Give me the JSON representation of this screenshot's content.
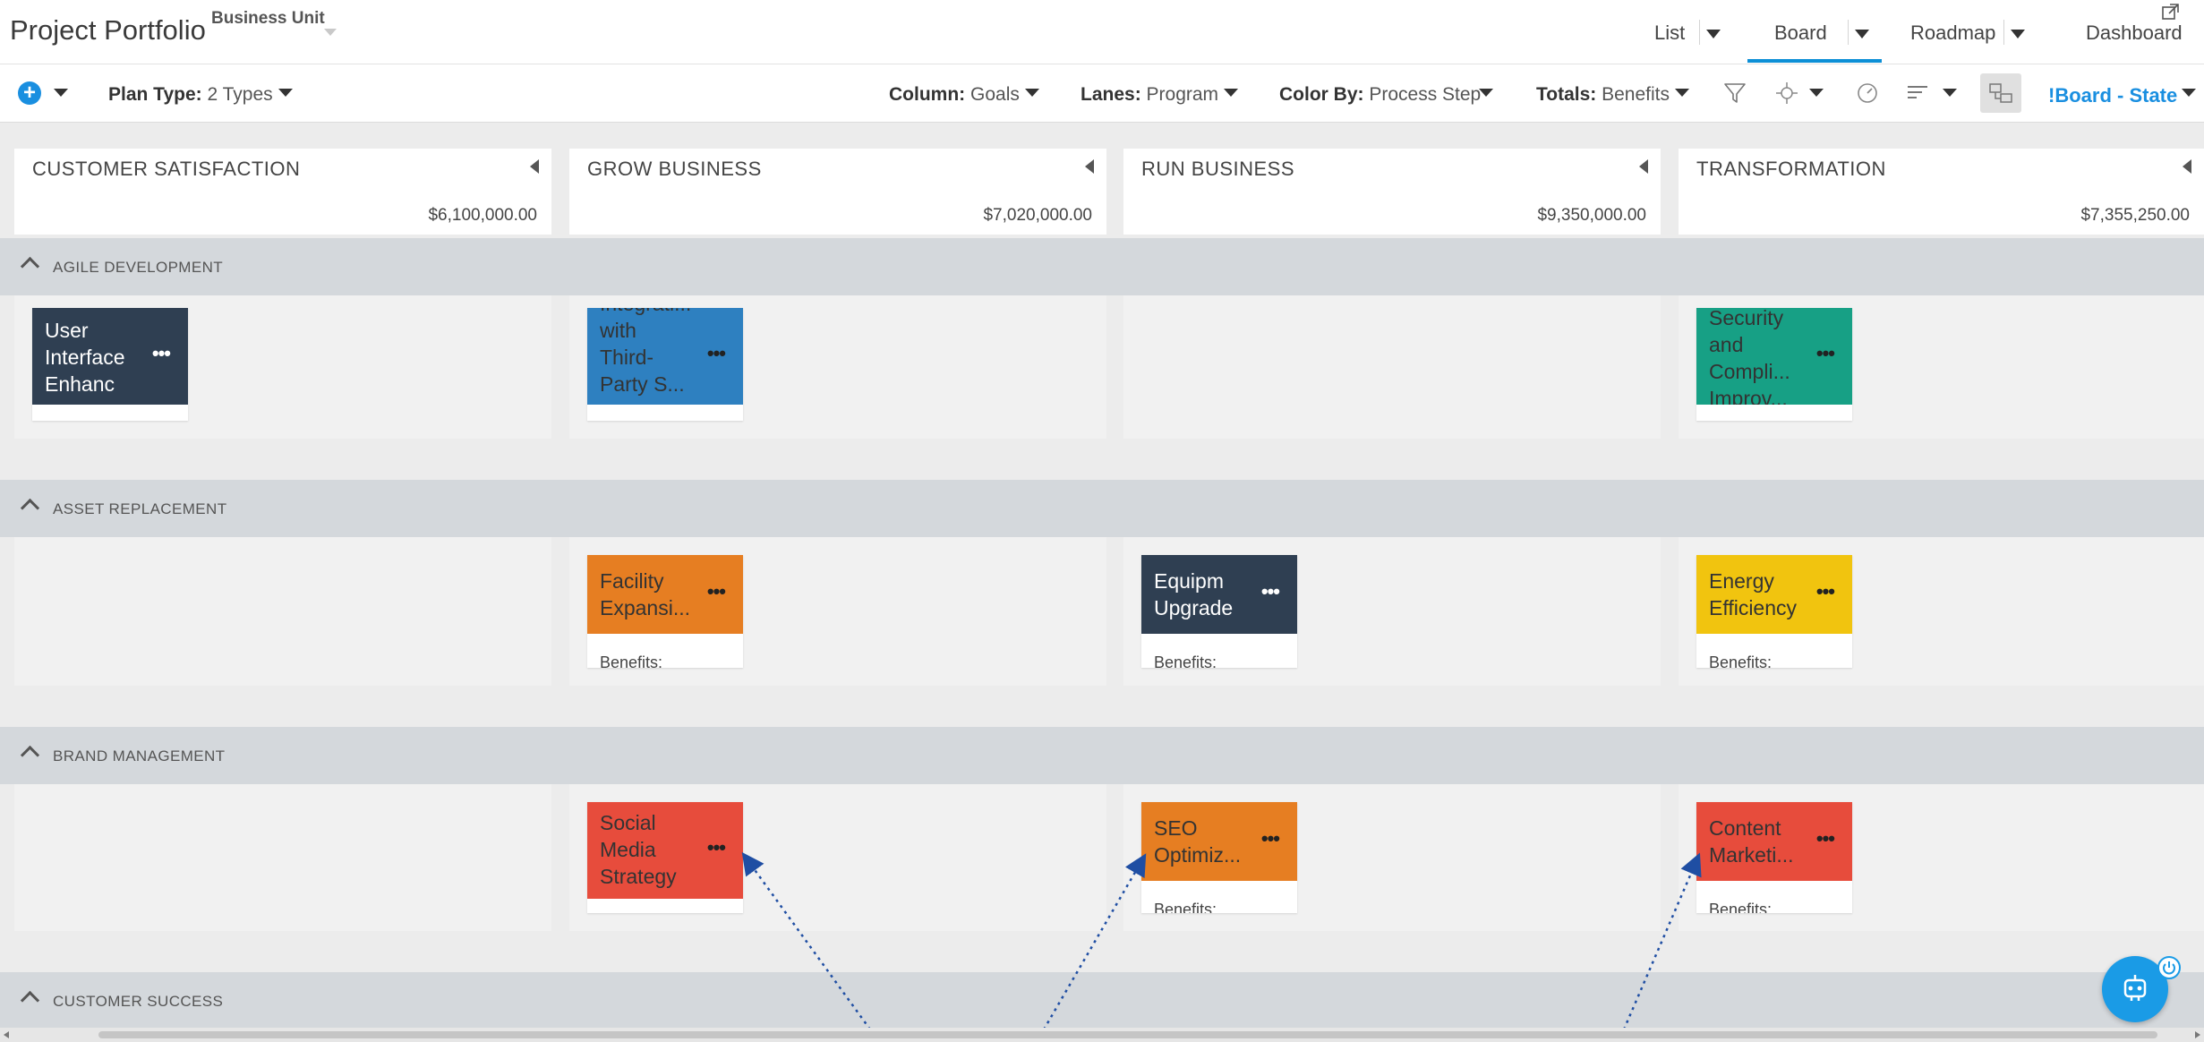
{
  "header": {
    "app_title": "Project Portfolio",
    "business_unit_label": "Business Unit",
    "nav": [
      {
        "label": "List"
      },
      {
        "label": "Board",
        "active": true
      },
      {
        "label": "Roadmap"
      },
      {
        "label": "Dashboard"
      }
    ]
  },
  "toolbar": {
    "plan_type": {
      "label": "Plan Type:",
      "value": "2 Types"
    },
    "column": {
      "label": "Column:",
      "value": "Goals"
    },
    "lanes": {
      "label": "Lanes:",
      "value": "Program"
    },
    "color_by": {
      "label": "Color By:",
      "value": "Process Step"
    },
    "totals": {
      "label": "Totals:",
      "value": "Benefits"
    },
    "view_state": "!Board - State"
  },
  "columns": [
    {
      "title": "CUSTOMER SATISFACTION",
      "total": "$6,100,000.00"
    },
    {
      "title": "GROW BUSINESS",
      "total": "$7,020,000.00"
    },
    {
      "title": "RUN BUSINESS",
      "total": "$9,350,000.00"
    },
    {
      "title": "TRANSFORMATION",
      "total": "$7,355,250.00"
    }
  ],
  "lanes": [
    {
      "title": "AGILE DEVELOPMENT",
      "cards": [
        {
          "title": "User Interface Enhanc",
          "color": "#2f3f52",
          "text_color": "#ffffff"
        },
        {
          "title": "Integrati... with Third-Party S...",
          "color": "#2e80c0",
          "text_color": "#333333"
        },
        {
          "title": "Security and Compli... Improv...",
          "color": "#17a085",
          "text_color": "#333333"
        }
      ]
    },
    {
      "title": "ASSET REPLACEMENT",
      "cards": [
        {
          "title": "Facility Expansi...",
          "color": "#e67e22",
          "text_color": "#333333",
          "benefits": "Benefits:"
        },
        {
          "title": "Equipm Upgrade",
          "color": "#2f3f52",
          "text_color": "#ffffff",
          "benefits": "Benefits:"
        },
        {
          "title": "Energy Efficiency",
          "color": "#f1c40f",
          "text_color": "#333333",
          "benefits": "Benefits:"
        }
      ]
    },
    {
      "title": "BRAND MANAGEMENT",
      "cards": [
        {
          "title": "Social Media Strategy",
          "color": "#e74c3c",
          "text_color": "#333333"
        },
        {
          "title": "SEO Optimiz...",
          "color": "#e67e22",
          "text_color": "#333333",
          "benefits": "Benefits:"
        },
        {
          "title": "Content Marketi...",
          "color": "#e74c3c",
          "text_color": "#333333",
          "benefits": "Benefits:"
        }
      ]
    },
    {
      "title": "CUSTOMER SUCCESS",
      "cards": []
    }
  ],
  "icons": {
    "add": "plus-circle-icon",
    "filter": "funnel-icon",
    "move": "crosshair-move-icon",
    "gauge": "speedometer-icon",
    "sort": "lines-sort-icon",
    "toggle": "dependency-toggle-icon",
    "expand": "open-new-window-icon",
    "assistant": "robot-assistant-icon"
  }
}
